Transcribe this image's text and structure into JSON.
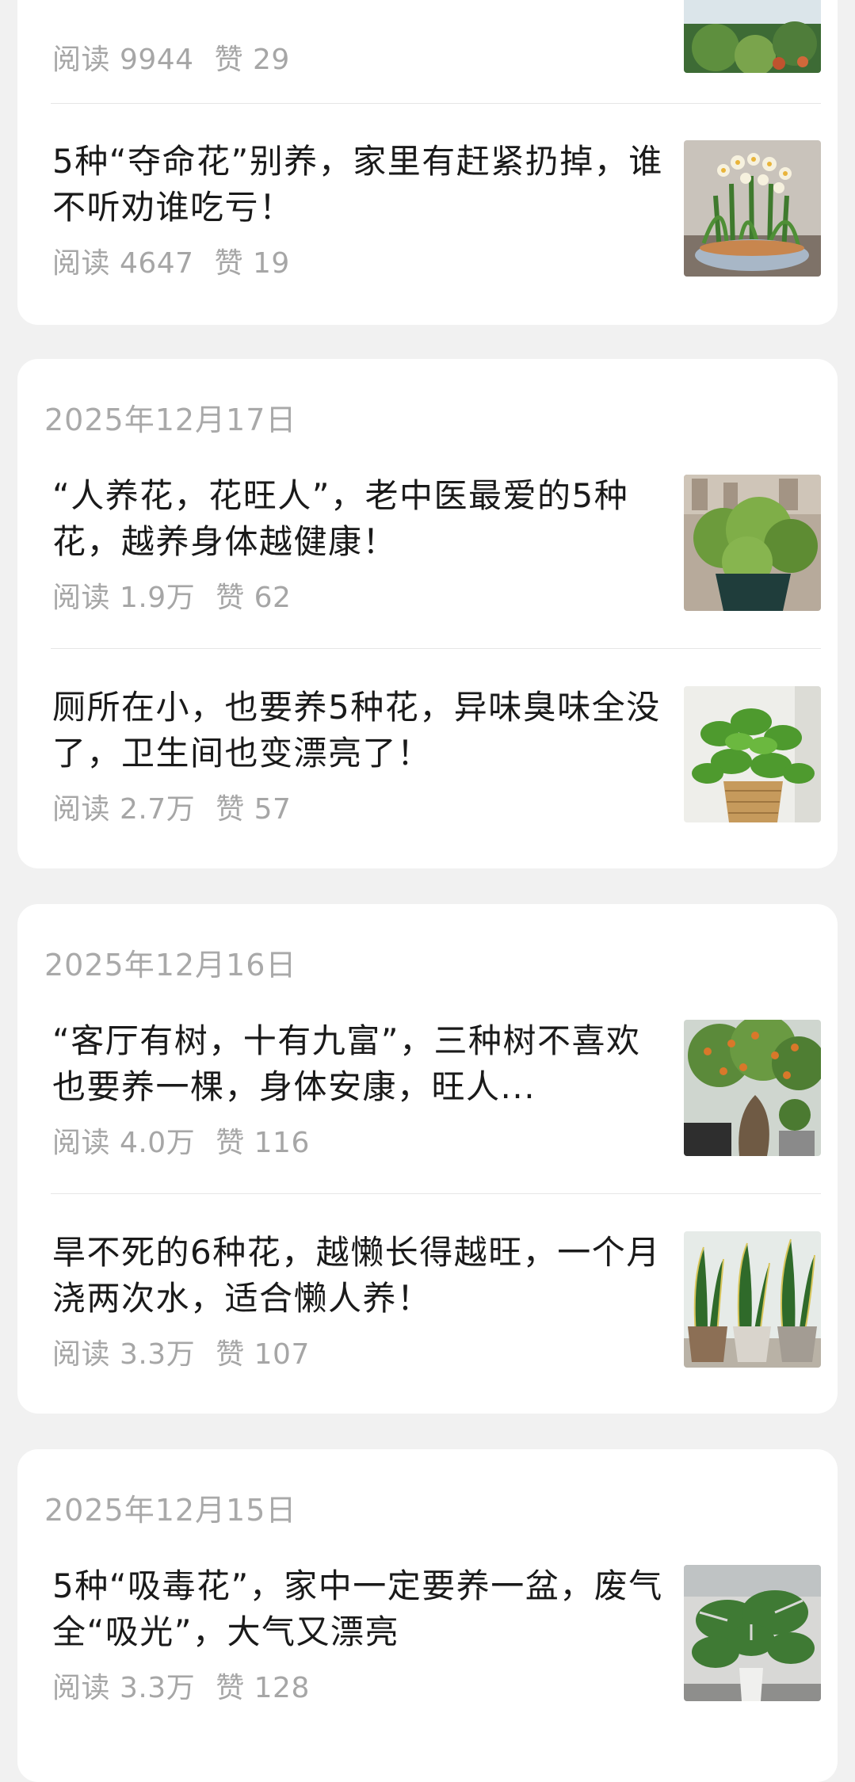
{
  "feed": {
    "groups": [
      {
        "date": "",
        "items": [
          {
            "title": "",
            "reads": "阅读 9944",
            "likes": "赞 29",
            "image": "tree-branch-photo"
          },
          {
            "title": "5种“夺命花”别养，家里有赶紧扔掉，谁不听劝谁吃亏！",
            "reads": "阅读 4647",
            "likes": "赞 19",
            "image": "narcissus-pot-photo"
          }
        ]
      },
      {
        "date": "2025年12月17日",
        "items": [
          {
            "title": "“人养花，花旺人”，老中医最爱的5种花，越养身体越健康！",
            "reads": "阅读 1.9万",
            "likes": "赞 62",
            "image": "green-shrub-pot-photo"
          },
          {
            "title": "厕所在小，也要养5种花，异味臭味全没了，卫生间也变漂亮了！",
            "reads": "阅读 2.7万",
            "likes": "赞 57",
            "image": "pothos-basket-photo"
          }
        ]
      },
      {
        "date": "2025年12月16日",
        "items": [
          {
            "title": "“客厅有树，十有九富”，三种树不喜欢也要养一棵，身体安康，旺人...",
            "reads": "阅读 4.0万",
            "likes": "赞 116",
            "image": "bonsai-fruit-tree-photo"
          },
          {
            "title": "旱不死的6种花，越懒长得越旺，一个月浇两次水，适合懒人养！",
            "reads": "阅读 3.3万",
            "likes": "赞 107",
            "image": "snake-plants-photo"
          }
        ]
      },
      {
        "date": "2025年12月15日",
        "items": [
          {
            "title": "5种“吸毒花”，家中一定要养一盆，废气全“吸光”，大气又漂亮",
            "reads": "阅读 3.3万",
            "likes": "赞 128",
            "image": "monstera-pot-photo"
          }
        ]
      }
    ]
  }
}
